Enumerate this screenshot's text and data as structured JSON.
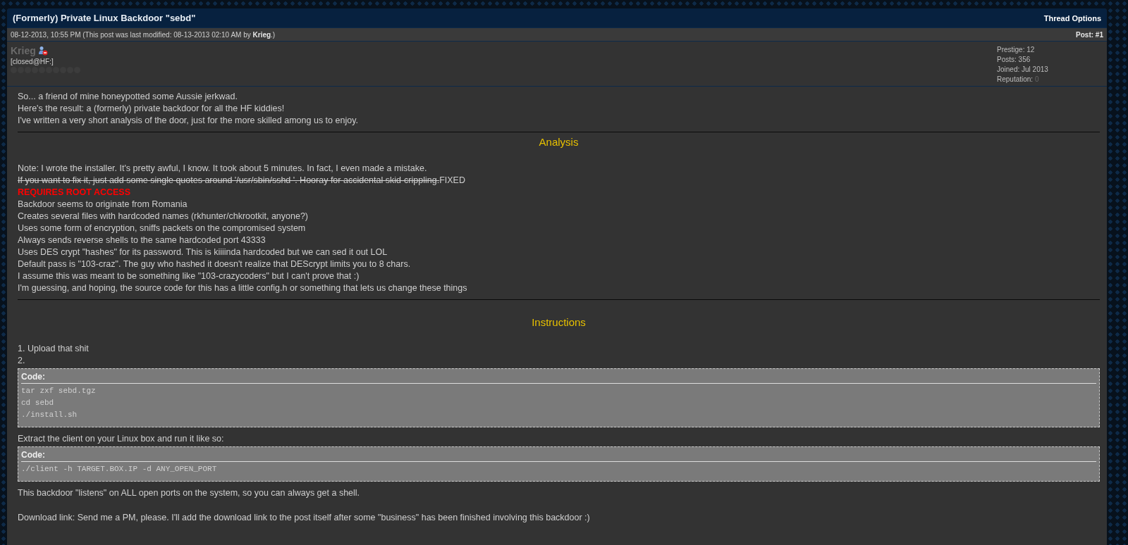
{
  "thread": {
    "title": "(Formerly) Private Linux Backdoor \"sebd\"",
    "options": "Thread Options"
  },
  "post": {
    "date": "08-12-2013, 10:55 PM",
    "modified_prefix": "(This post was last modified: 08-13-2013 02:10 AM by",
    "modified_by": "Krieg",
    "modified_suffix": ".)",
    "number": "Post: #1"
  },
  "author": {
    "name": "Krieg",
    "online": false,
    "usertitle": "[closed@HF:]",
    "stats": [
      {
        "label": "Prestige:",
        "value": "12",
        "muted": false
      },
      {
        "label": "Posts:",
        "value": "356",
        "muted": false
      },
      {
        "label": "Joined:",
        "value": "Jul 2013",
        "muted": false
      },
      {
        "label": "Reputation:",
        "value": "0",
        "muted": true
      }
    ]
  },
  "body": [
    {
      "kind": "line",
      "text": "So... a friend of mine honeypotted some Aussie jerkwad."
    },
    {
      "kind": "line",
      "text": "Here's the result: a (formerly) private backdoor for all the HF kiddies!"
    },
    {
      "kind": "line",
      "text": "I've written a very short analysis of the door, just for the more skilled among us to enjoy."
    },
    {
      "kind": "rule"
    },
    {
      "kind": "heading",
      "text": "Analysis"
    },
    {
      "kind": "gap"
    },
    {
      "kind": "line",
      "text": "Note: I wrote the installer. It's pretty awful, I know. It took about 5 minutes. In fact, I even made a mistake."
    },
    {
      "kind": "struck",
      "text": "If you want to fix it, just add some single quotes around '/usr/sbin/sshd '. Hooray for accidental skid-crippling.",
      "tail": "FIXED"
    },
    {
      "kind": "alert",
      "text": "REQUIRES ROOT ACCESS"
    },
    {
      "kind": "line",
      "text": "Backdoor seems to originate from Romania"
    },
    {
      "kind": "line",
      "text": "Creates several files with hardcoded names (rkhunter/chkrootkit, anyone?)"
    },
    {
      "kind": "line",
      "text": "Uses some form of encryption, sniffs packets on the compromised system"
    },
    {
      "kind": "line",
      "text": "Always sends reverse shells to the same hardcoded port 43333"
    },
    {
      "kind": "line",
      "text": "Uses DES crypt \"hashes\" for its password. This is kiiiinda hardcoded but we can sed it out LOL"
    },
    {
      "kind": "line",
      "text": "Default pass is \"103-craz\". The guy who hashed it doesn't realize that DEScrypt limits you to 8 chars."
    },
    {
      "kind": "line",
      "text": "I assume this was meant to be something like \"103-crazycoders\" but I can't prove that :)"
    },
    {
      "kind": "line",
      "text": "I'm guessing, and hoping, the source code for this has a little config.h or something that lets us change these things"
    },
    {
      "kind": "rule"
    },
    {
      "kind": "gap"
    },
    {
      "kind": "heading",
      "text": "Instructions"
    },
    {
      "kind": "gap"
    },
    {
      "kind": "line",
      "text": "1. Upload that shit"
    },
    {
      "kind": "line",
      "text": "2."
    },
    {
      "kind": "code",
      "label": "Code:",
      "lines": [
        "tar zxf sebd.tgz",
        "cd sebd",
        "./install.sh"
      ]
    },
    {
      "kind": "line",
      "text": "Extract the client on your Linux box and run it like so:"
    },
    {
      "kind": "code",
      "label": "Code:",
      "lines": [
        "./client -h TARGET.BOX.IP -d ANY_OPEN_PORT"
      ]
    },
    {
      "kind": "line",
      "text": "This backdoor \"listens\" on ALL open ports on the system, so you can always get a shell."
    },
    {
      "kind": "gap"
    },
    {
      "kind": "line",
      "text": "Download link: Send me a PM, please. I'll add the download link to the post itself after some \"business\" has been finished involving this backdoor :)"
    }
  ]
}
